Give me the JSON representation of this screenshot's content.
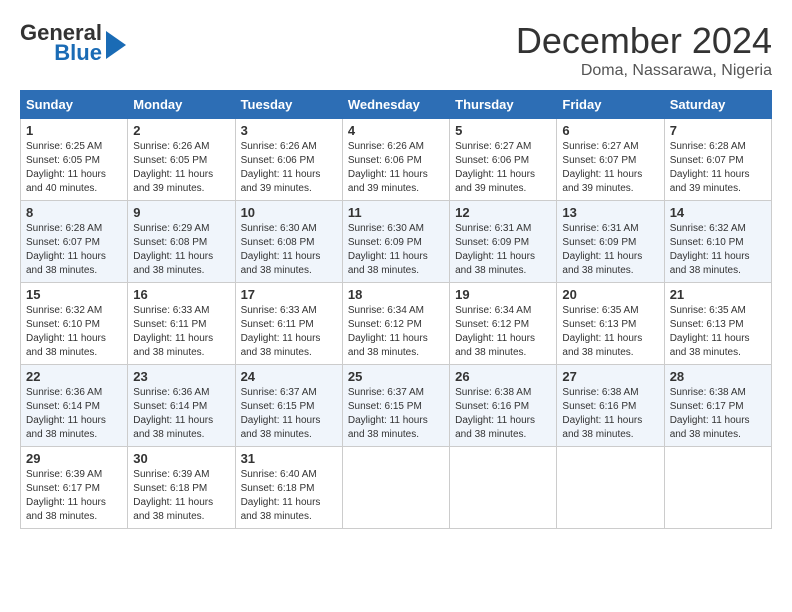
{
  "header": {
    "logo_general": "General",
    "logo_blue": "Blue",
    "month_title": "December 2024",
    "location": "Doma, Nassarawa, Nigeria"
  },
  "days_of_week": [
    "Sunday",
    "Monday",
    "Tuesday",
    "Wednesday",
    "Thursday",
    "Friday",
    "Saturday"
  ],
  "weeks": [
    [
      {
        "day": "1",
        "sunrise": "6:25 AM",
        "sunset": "6:05 PM",
        "daylight": "11 hours and 40 minutes."
      },
      {
        "day": "2",
        "sunrise": "6:26 AM",
        "sunset": "6:05 PM",
        "daylight": "11 hours and 39 minutes."
      },
      {
        "day": "3",
        "sunrise": "6:26 AM",
        "sunset": "6:06 PM",
        "daylight": "11 hours and 39 minutes."
      },
      {
        "day": "4",
        "sunrise": "6:26 AM",
        "sunset": "6:06 PM",
        "daylight": "11 hours and 39 minutes."
      },
      {
        "day": "5",
        "sunrise": "6:27 AM",
        "sunset": "6:06 PM",
        "daylight": "11 hours and 39 minutes."
      },
      {
        "day": "6",
        "sunrise": "6:27 AM",
        "sunset": "6:07 PM",
        "daylight": "11 hours and 39 minutes."
      },
      {
        "day": "7",
        "sunrise": "6:28 AM",
        "sunset": "6:07 PM",
        "daylight": "11 hours and 39 minutes."
      }
    ],
    [
      {
        "day": "8",
        "sunrise": "6:28 AM",
        "sunset": "6:07 PM",
        "daylight": "11 hours and 38 minutes."
      },
      {
        "day": "9",
        "sunrise": "6:29 AM",
        "sunset": "6:08 PM",
        "daylight": "11 hours and 38 minutes."
      },
      {
        "day": "10",
        "sunrise": "6:30 AM",
        "sunset": "6:08 PM",
        "daylight": "11 hours and 38 minutes."
      },
      {
        "day": "11",
        "sunrise": "6:30 AM",
        "sunset": "6:09 PM",
        "daylight": "11 hours and 38 minutes."
      },
      {
        "day": "12",
        "sunrise": "6:31 AM",
        "sunset": "6:09 PM",
        "daylight": "11 hours and 38 minutes."
      },
      {
        "day": "13",
        "sunrise": "6:31 AM",
        "sunset": "6:09 PM",
        "daylight": "11 hours and 38 minutes."
      },
      {
        "day": "14",
        "sunrise": "6:32 AM",
        "sunset": "6:10 PM",
        "daylight": "11 hours and 38 minutes."
      }
    ],
    [
      {
        "day": "15",
        "sunrise": "6:32 AM",
        "sunset": "6:10 PM",
        "daylight": "11 hours and 38 minutes."
      },
      {
        "day": "16",
        "sunrise": "6:33 AM",
        "sunset": "6:11 PM",
        "daylight": "11 hours and 38 minutes."
      },
      {
        "day": "17",
        "sunrise": "6:33 AM",
        "sunset": "6:11 PM",
        "daylight": "11 hours and 38 minutes."
      },
      {
        "day": "18",
        "sunrise": "6:34 AM",
        "sunset": "6:12 PM",
        "daylight": "11 hours and 38 minutes."
      },
      {
        "day": "19",
        "sunrise": "6:34 AM",
        "sunset": "6:12 PM",
        "daylight": "11 hours and 38 minutes."
      },
      {
        "day": "20",
        "sunrise": "6:35 AM",
        "sunset": "6:13 PM",
        "daylight": "11 hours and 38 minutes."
      },
      {
        "day": "21",
        "sunrise": "6:35 AM",
        "sunset": "6:13 PM",
        "daylight": "11 hours and 38 minutes."
      }
    ],
    [
      {
        "day": "22",
        "sunrise": "6:36 AM",
        "sunset": "6:14 PM",
        "daylight": "11 hours and 38 minutes."
      },
      {
        "day": "23",
        "sunrise": "6:36 AM",
        "sunset": "6:14 PM",
        "daylight": "11 hours and 38 minutes."
      },
      {
        "day": "24",
        "sunrise": "6:37 AM",
        "sunset": "6:15 PM",
        "daylight": "11 hours and 38 minutes."
      },
      {
        "day": "25",
        "sunrise": "6:37 AM",
        "sunset": "6:15 PM",
        "daylight": "11 hours and 38 minutes."
      },
      {
        "day": "26",
        "sunrise": "6:38 AM",
        "sunset": "6:16 PM",
        "daylight": "11 hours and 38 minutes."
      },
      {
        "day": "27",
        "sunrise": "6:38 AM",
        "sunset": "6:16 PM",
        "daylight": "11 hours and 38 minutes."
      },
      {
        "day": "28",
        "sunrise": "6:38 AM",
        "sunset": "6:17 PM",
        "daylight": "11 hours and 38 minutes."
      }
    ],
    [
      {
        "day": "29",
        "sunrise": "6:39 AM",
        "sunset": "6:17 PM",
        "daylight": "11 hours and 38 minutes."
      },
      {
        "day": "30",
        "sunrise": "6:39 AM",
        "sunset": "6:18 PM",
        "daylight": "11 hours and 38 minutes."
      },
      {
        "day": "31",
        "sunrise": "6:40 AM",
        "sunset": "6:18 PM",
        "daylight": "11 hours and 38 minutes."
      },
      null,
      null,
      null,
      null
    ]
  ],
  "labels": {
    "sunrise": "Sunrise:",
    "sunset": "Sunset:",
    "daylight": "Daylight:"
  }
}
